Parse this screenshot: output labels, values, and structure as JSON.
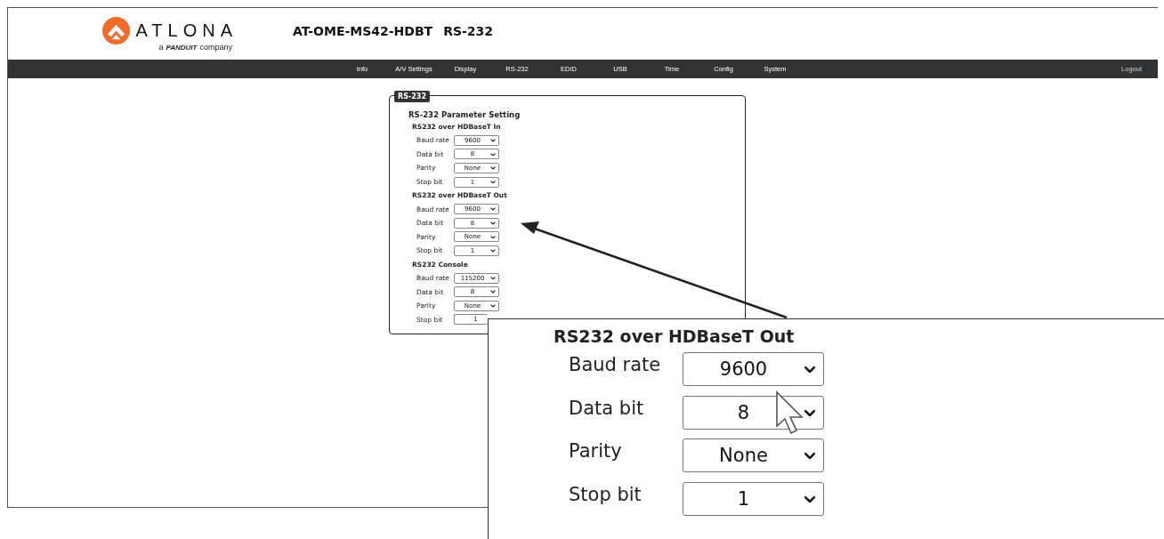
{
  "header": {
    "logo": {
      "wordmark": "ATLONA",
      "tagline": [
        "a",
        "PANDUIT",
        "company"
      ]
    },
    "title": [
      "AT-OME-MS42-HDBT",
      "RS-232"
    ]
  },
  "nav": {
    "items": [
      "Info",
      "A/V Settings",
      "Display",
      "RS-232",
      "EDID",
      "USB",
      "Time",
      "Config",
      "System"
    ],
    "logout": "Logout"
  },
  "panel": {
    "legend": "RS-232",
    "heading": "RS-232 Parameter Setting",
    "sections": [
      {
        "title": "RS232 over HDBaseT In",
        "fields": [
          {
            "label": "Baud rate",
            "value": "9600"
          },
          {
            "label": "Data bit",
            "value": "8"
          },
          {
            "label": "Parity",
            "value": "None"
          },
          {
            "label": "Stop bit",
            "value": "1"
          }
        ]
      },
      {
        "title": "RS232 over HDBaseT Out",
        "fields": [
          {
            "label": "Baud rate",
            "value": "9600"
          },
          {
            "label": "Data bit",
            "value": "8"
          },
          {
            "label": "Parity",
            "value": "None"
          },
          {
            "label": "Stop bit",
            "value": "1"
          }
        ]
      },
      {
        "title": "RS232 Console",
        "fields": [
          {
            "label": "Baud rate",
            "value": "115200"
          },
          {
            "label": "Data bit",
            "value": "8"
          },
          {
            "label": "Parity",
            "value": "None"
          },
          {
            "label": "Stop bit",
            "value": "1"
          }
        ]
      }
    ]
  },
  "callout": {
    "title": "RS232 over HDBaseT Out",
    "fields": [
      {
        "label": "Baud rate",
        "value": "9600"
      },
      {
        "label": "Data bit",
        "value": "8"
      },
      {
        "label": "Parity",
        "value": "None"
      },
      {
        "label": "Stop bit",
        "value": "1"
      }
    ]
  }
}
